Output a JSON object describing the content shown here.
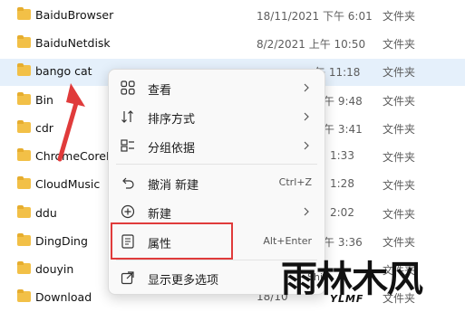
{
  "files": [
    {
      "name": "BaiduBrowser",
      "date": "18/11/2021 下午 6:01",
      "type": "文件夹"
    },
    {
      "name": "BaiduNetdisk",
      "date": "8/2/2021 上午 10:50",
      "type": "文件夹"
    },
    {
      "name": "bango cat",
      "date": "午 11:18",
      "type": "文件夹"
    },
    {
      "name": "Bin",
      "date": "午 9:48",
      "type": "文件夹"
    },
    {
      "name": "cdr",
      "date": "午 3:41",
      "type": "文件夹"
    },
    {
      "name": "ChromeCoreD",
      "date": "1:33",
      "type": "文件夹"
    },
    {
      "name": "CloudMusic",
      "date": "1:28",
      "type": "文件夹"
    },
    {
      "name": "ddu",
      "date": "2:02",
      "type": "文件夹"
    },
    {
      "name": "DingDing",
      "date": "午 3:36",
      "type": "文件夹"
    },
    {
      "name": "douyin",
      "date": "",
      "type": "文件夹"
    },
    {
      "name": "Download",
      "date": "18/10",
      "type": "文件夹"
    }
  ],
  "menu": {
    "items": [
      {
        "icon": "grid-view-icon",
        "label": "查看",
        "submenu": true
      },
      {
        "icon": "sort-icon",
        "label": "排序方式",
        "submenu": true
      },
      {
        "icon": "group-icon",
        "label": "分组依据",
        "submenu": true
      },
      {
        "icon": "undo-icon",
        "label": "撤消 新建",
        "shortcut": "Ctrl+Z"
      },
      {
        "icon": "new-plus-icon",
        "label": "新建",
        "submenu": true
      },
      {
        "icon": "properties-icon",
        "label": "属性",
        "shortcut": "Alt+Enter"
      },
      {
        "icon": "more-options-icon",
        "label": "显示更多选项",
        "shortcut": "Shi"
      }
    ]
  },
  "watermark": {
    "text": "雨林木风",
    "sub": "YLMF"
  },
  "colors": {
    "highlight": "#e03b3b",
    "arrow": "#e03b3b",
    "selected_row": "#e5f0fb"
  }
}
